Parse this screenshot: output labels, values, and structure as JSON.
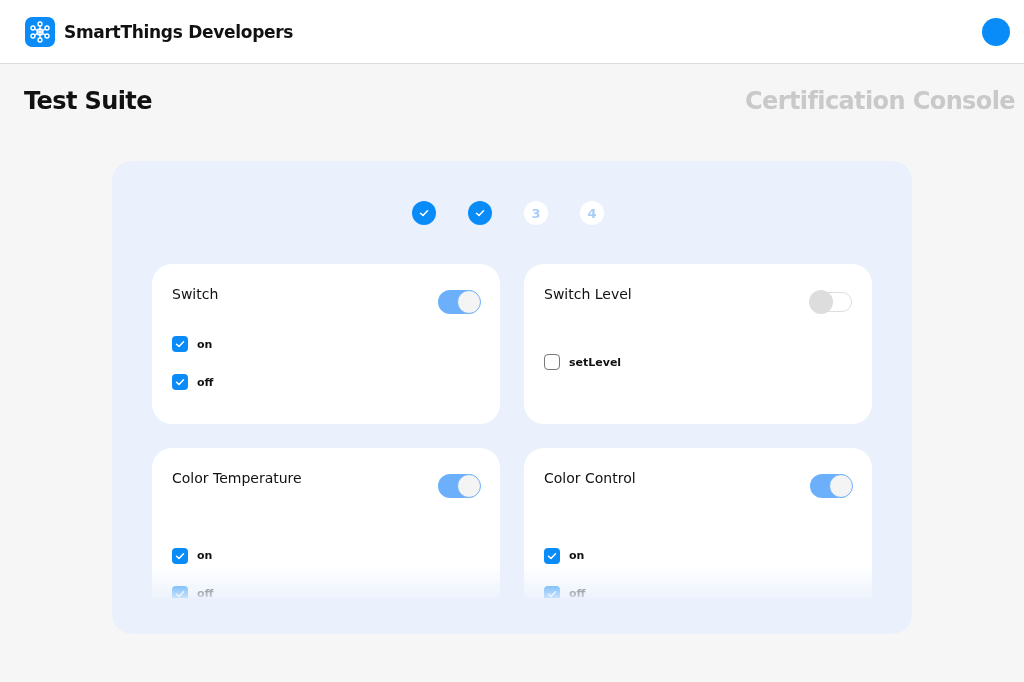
{
  "header": {
    "brand": "SmartThings Developers"
  },
  "page": {
    "title": "Test Suite",
    "subtitle": "Certification Console"
  },
  "steps": [
    {
      "kind": "done"
    },
    {
      "kind": "done"
    },
    {
      "kind": "number",
      "label": "3"
    },
    {
      "kind": "number",
      "label": "4"
    }
  ],
  "capabilities": [
    {
      "title": "Switch",
      "on": true,
      "commands": [
        {
          "label": "on",
          "checked": true
        },
        {
          "label": "off",
          "checked": true
        }
      ]
    },
    {
      "title": "Switch Level",
      "on": false,
      "commands": [
        {
          "label": "setLevel",
          "checked": false
        }
      ]
    },
    {
      "title": "Color Temperature",
      "on": true,
      "commands": [
        {
          "label": "on",
          "checked": true
        },
        {
          "label": "off",
          "checked": true
        }
      ]
    },
    {
      "title": "Color Control",
      "on": true,
      "commands": [
        {
          "label": "on",
          "checked": true
        },
        {
          "label": "off",
          "checked": true
        }
      ]
    }
  ]
}
